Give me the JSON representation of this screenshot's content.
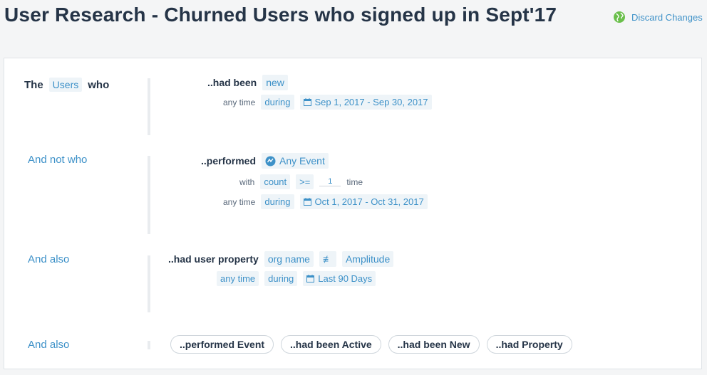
{
  "header": {
    "title": "User Research - Churned Users who signed up in Sept'17",
    "discard_label": "Discard Changes",
    "globe_icon": "globe-icon"
  },
  "segment1": {
    "the": "The",
    "users": "Users",
    "who": "who",
    "had_been_label": "..had been",
    "had_been_value": "new",
    "any_time": "any time",
    "during": "during",
    "date_range": "Sep 1, 2017 - Sep 30, 2017"
  },
  "segment2": {
    "left_label": "And not who",
    "performed_label": "..performed",
    "event": "Any Event",
    "with": "with",
    "count": "count",
    "operator": ">=",
    "count_value": "1",
    "time": "time",
    "any_time": "any time",
    "during": "during",
    "date_range": "Oct 1, 2017 - Oct 31, 2017"
  },
  "segment3": {
    "left_label": "And also",
    "property_label": "..had user property",
    "property": "org name",
    "operator": "≢",
    "value": "Amplitude",
    "any_time": "any time",
    "during": "during",
    "date_range": "Last 90 Days"
  },
  "segment4": {
    "left_label": "And also",
    "options": [
      "..performed Event",
      "..had been Active",
      "..had been New",
      "..had Property"
    ]
  },
  "colors": {
    "accent": "#3d91c8",
    "chip_bg": "#eef4f8",
    "text_dark": "#253447",
    "globe": "#6abf4b"
  }
}
